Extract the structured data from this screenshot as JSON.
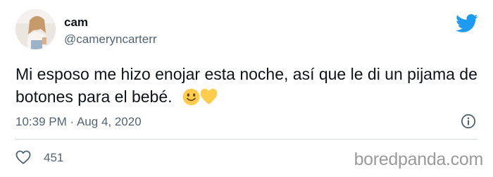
{
  "author": {
    "display_name": "cam",
    "handle": "@cameryncarterr"
  },
  "tweet": {
    "text": "Mi esposo me hizo enojar esta noche, así que le di un pijama de botones para el bebé.",
    "emojis": [
      "slightly-smiling-face",
      "yellow-heart"
    ],
    "time": "10:39 PM",
    "separator": "·",
    "date": "Aug 4, 2020",
    "likes": "451"
  },
  "icons": {
    "brand": "twitter-bird-icon",
    "info": "info-icon",
    "like": "heart-outline-icon"
  },
  "colors": {
    "brand_blue": "#1d9bf0",
    "secondary_text": "#536471",
    "divider": "#cfd9de"
  },
  "watermark": "boredpanda.com"
}
